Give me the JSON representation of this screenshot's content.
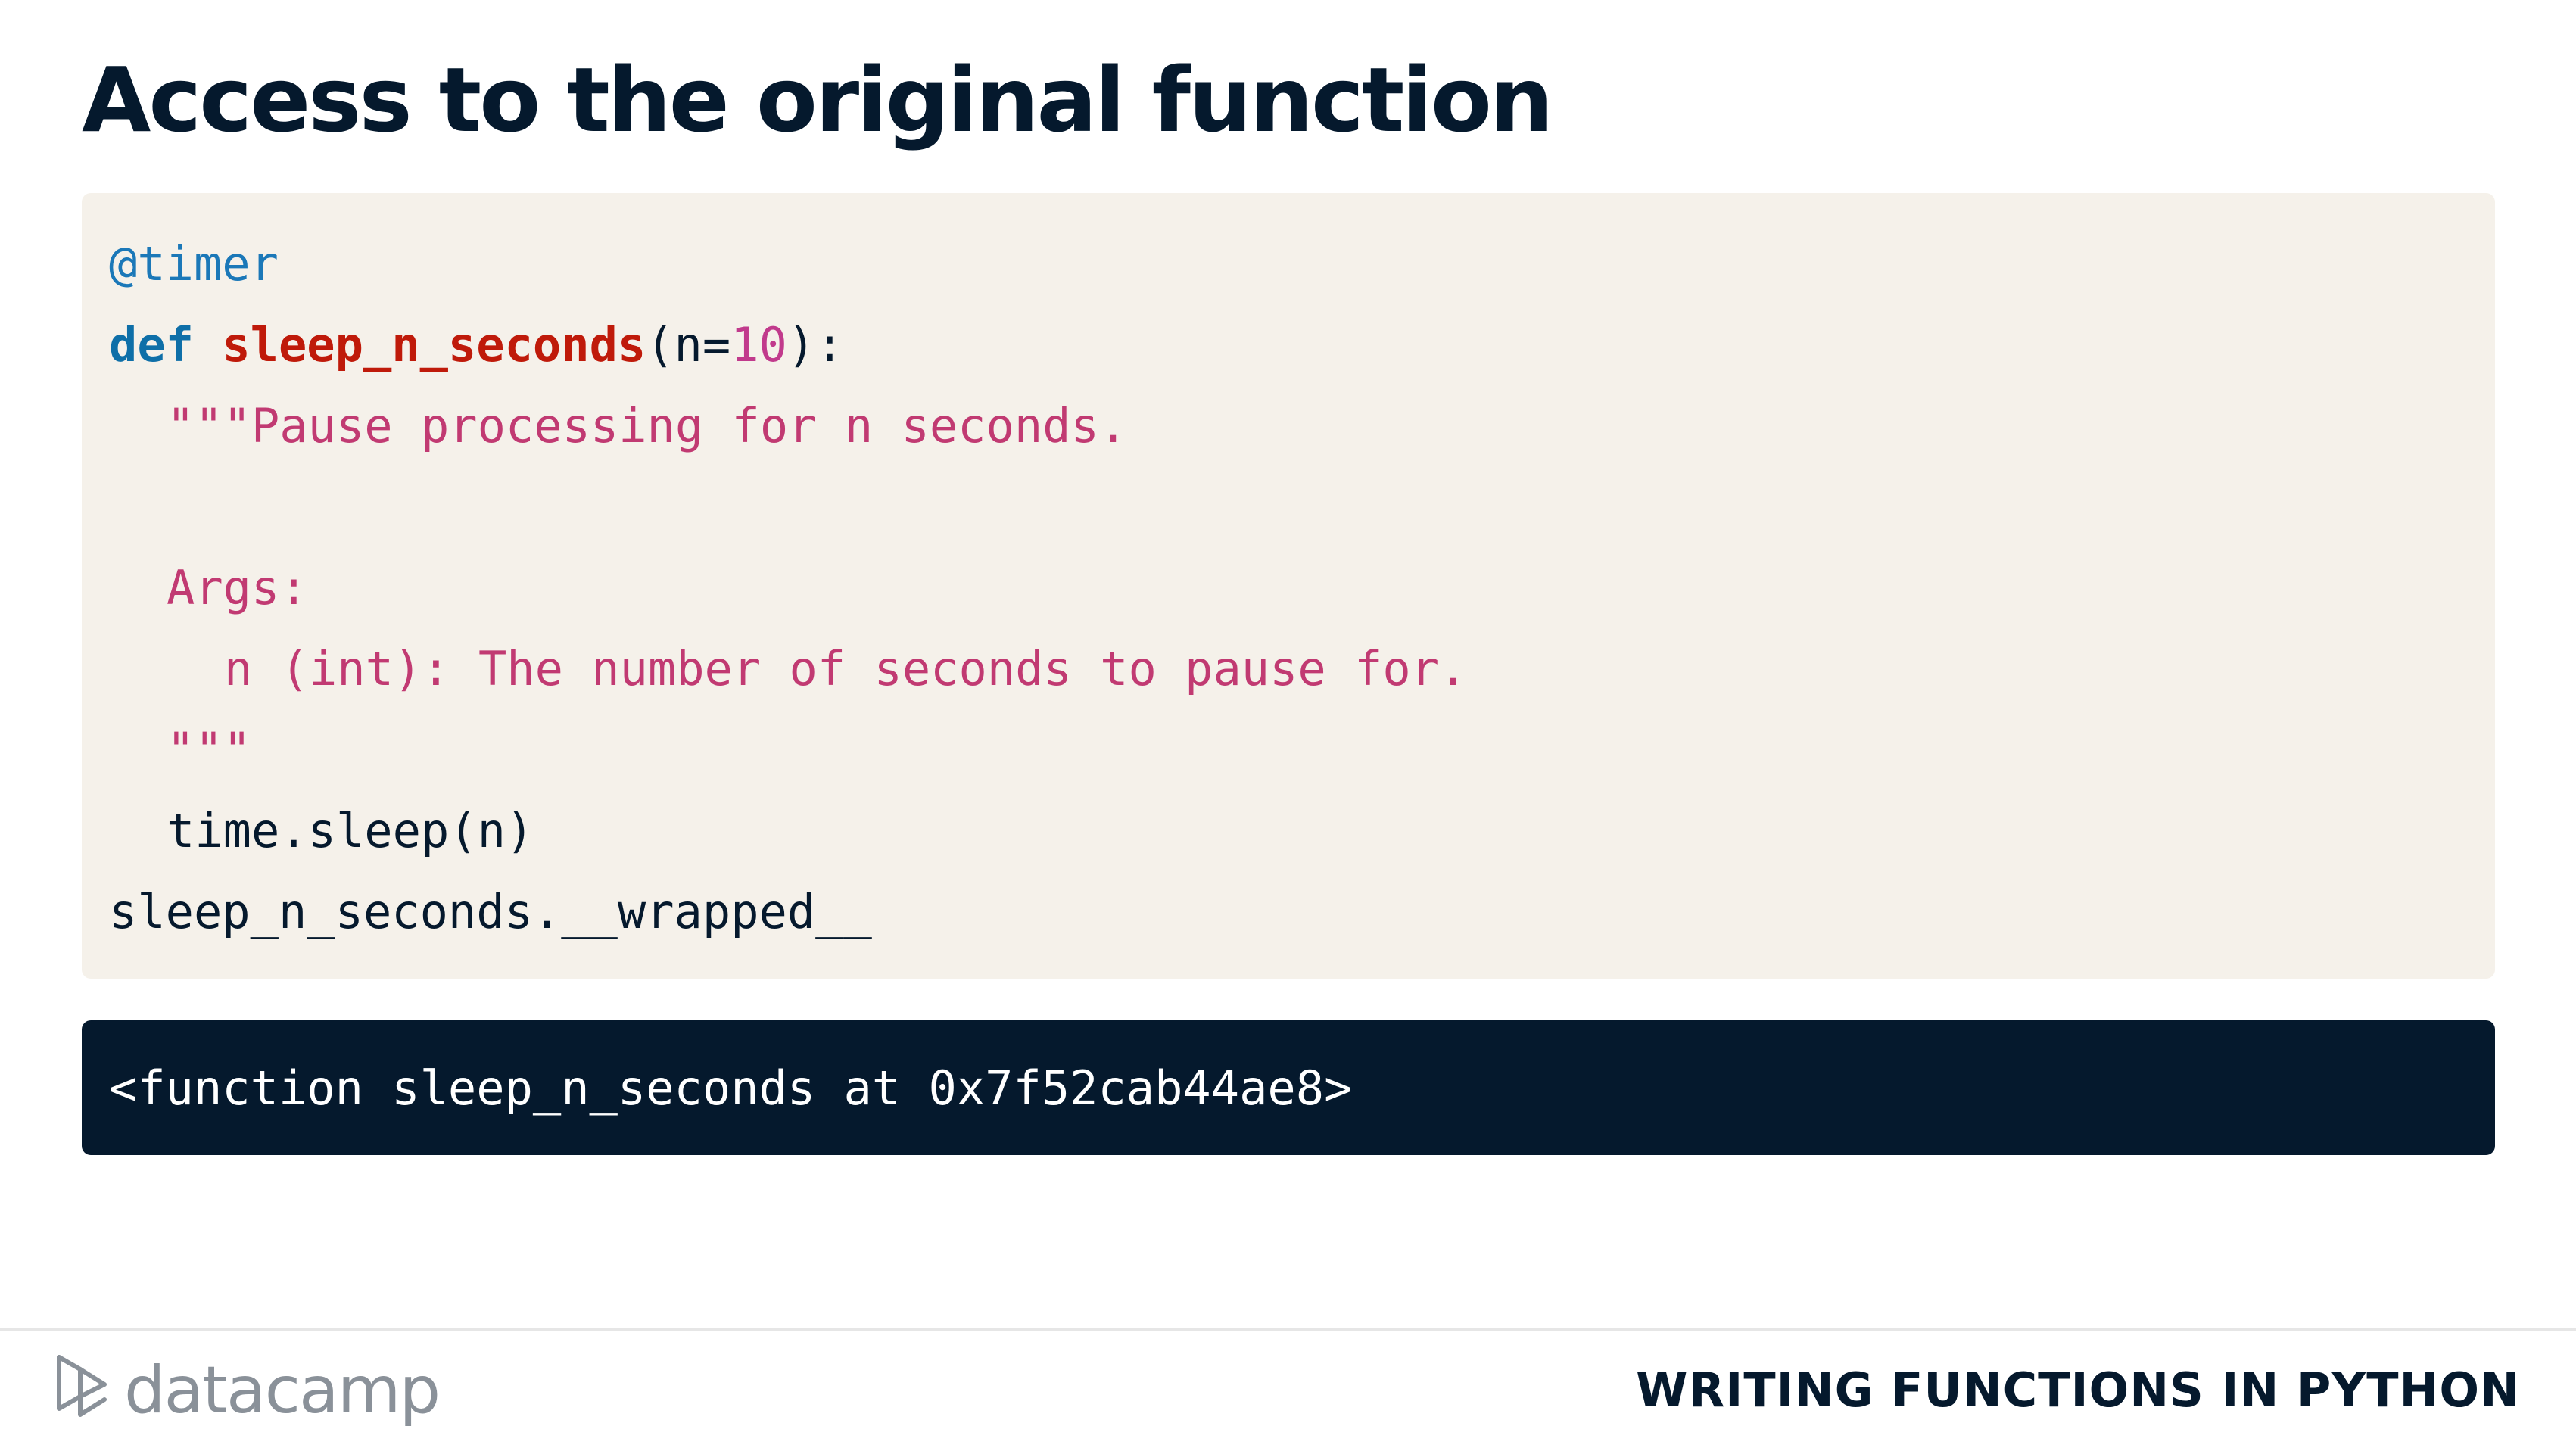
{
  "slide": {
    "title": "Access to the original function"
  },
  "code": {
    "line1": {
      "decorator": "@timer"
    },
    "line2": {
      "keyword": "def",
      "space": " ",
      "func_name": "sleep_n_seconds",
      "open": "(n=",
      "default": "10",
      "close": "):"
    },
    "line3": {
      "text": "\"\"\"Pause processing for n seconds."
    },
    "line4": {
      "text": ""
    },
    "line5": {
      "text": "Args:"
    },
    "line6": {
      "text": "n (int): The number of seconds to pause for."
    },
    "line7": {
      "text": "\"\"\""
    },
    "line8": {
      "text": "time.sleep(n)"
    },
    "line9": {
      "text": "sleep_n_seconds.__wrapped__"
    }
  },
  "output": {
    "text": "<function sleep_n_seconds at 0x7f52cab44ae8>"
  },
  "footer": {
    "brand": "datacamp",
    "brand_icon": "datacamp-logo-icon",
    "course": "WRITING FUNCTIONS IN PYTHON"
  },
  "colors": {
    "title": "#05192d",
    "code_background": "#f5f1ea",
    "output_background": "#05192d",
    "keyword": "#0e6fa8",
    "function_name": "#bf1a0a",
    "string": "#c13a72",
    "number": "#c13a8c"
  }
}
